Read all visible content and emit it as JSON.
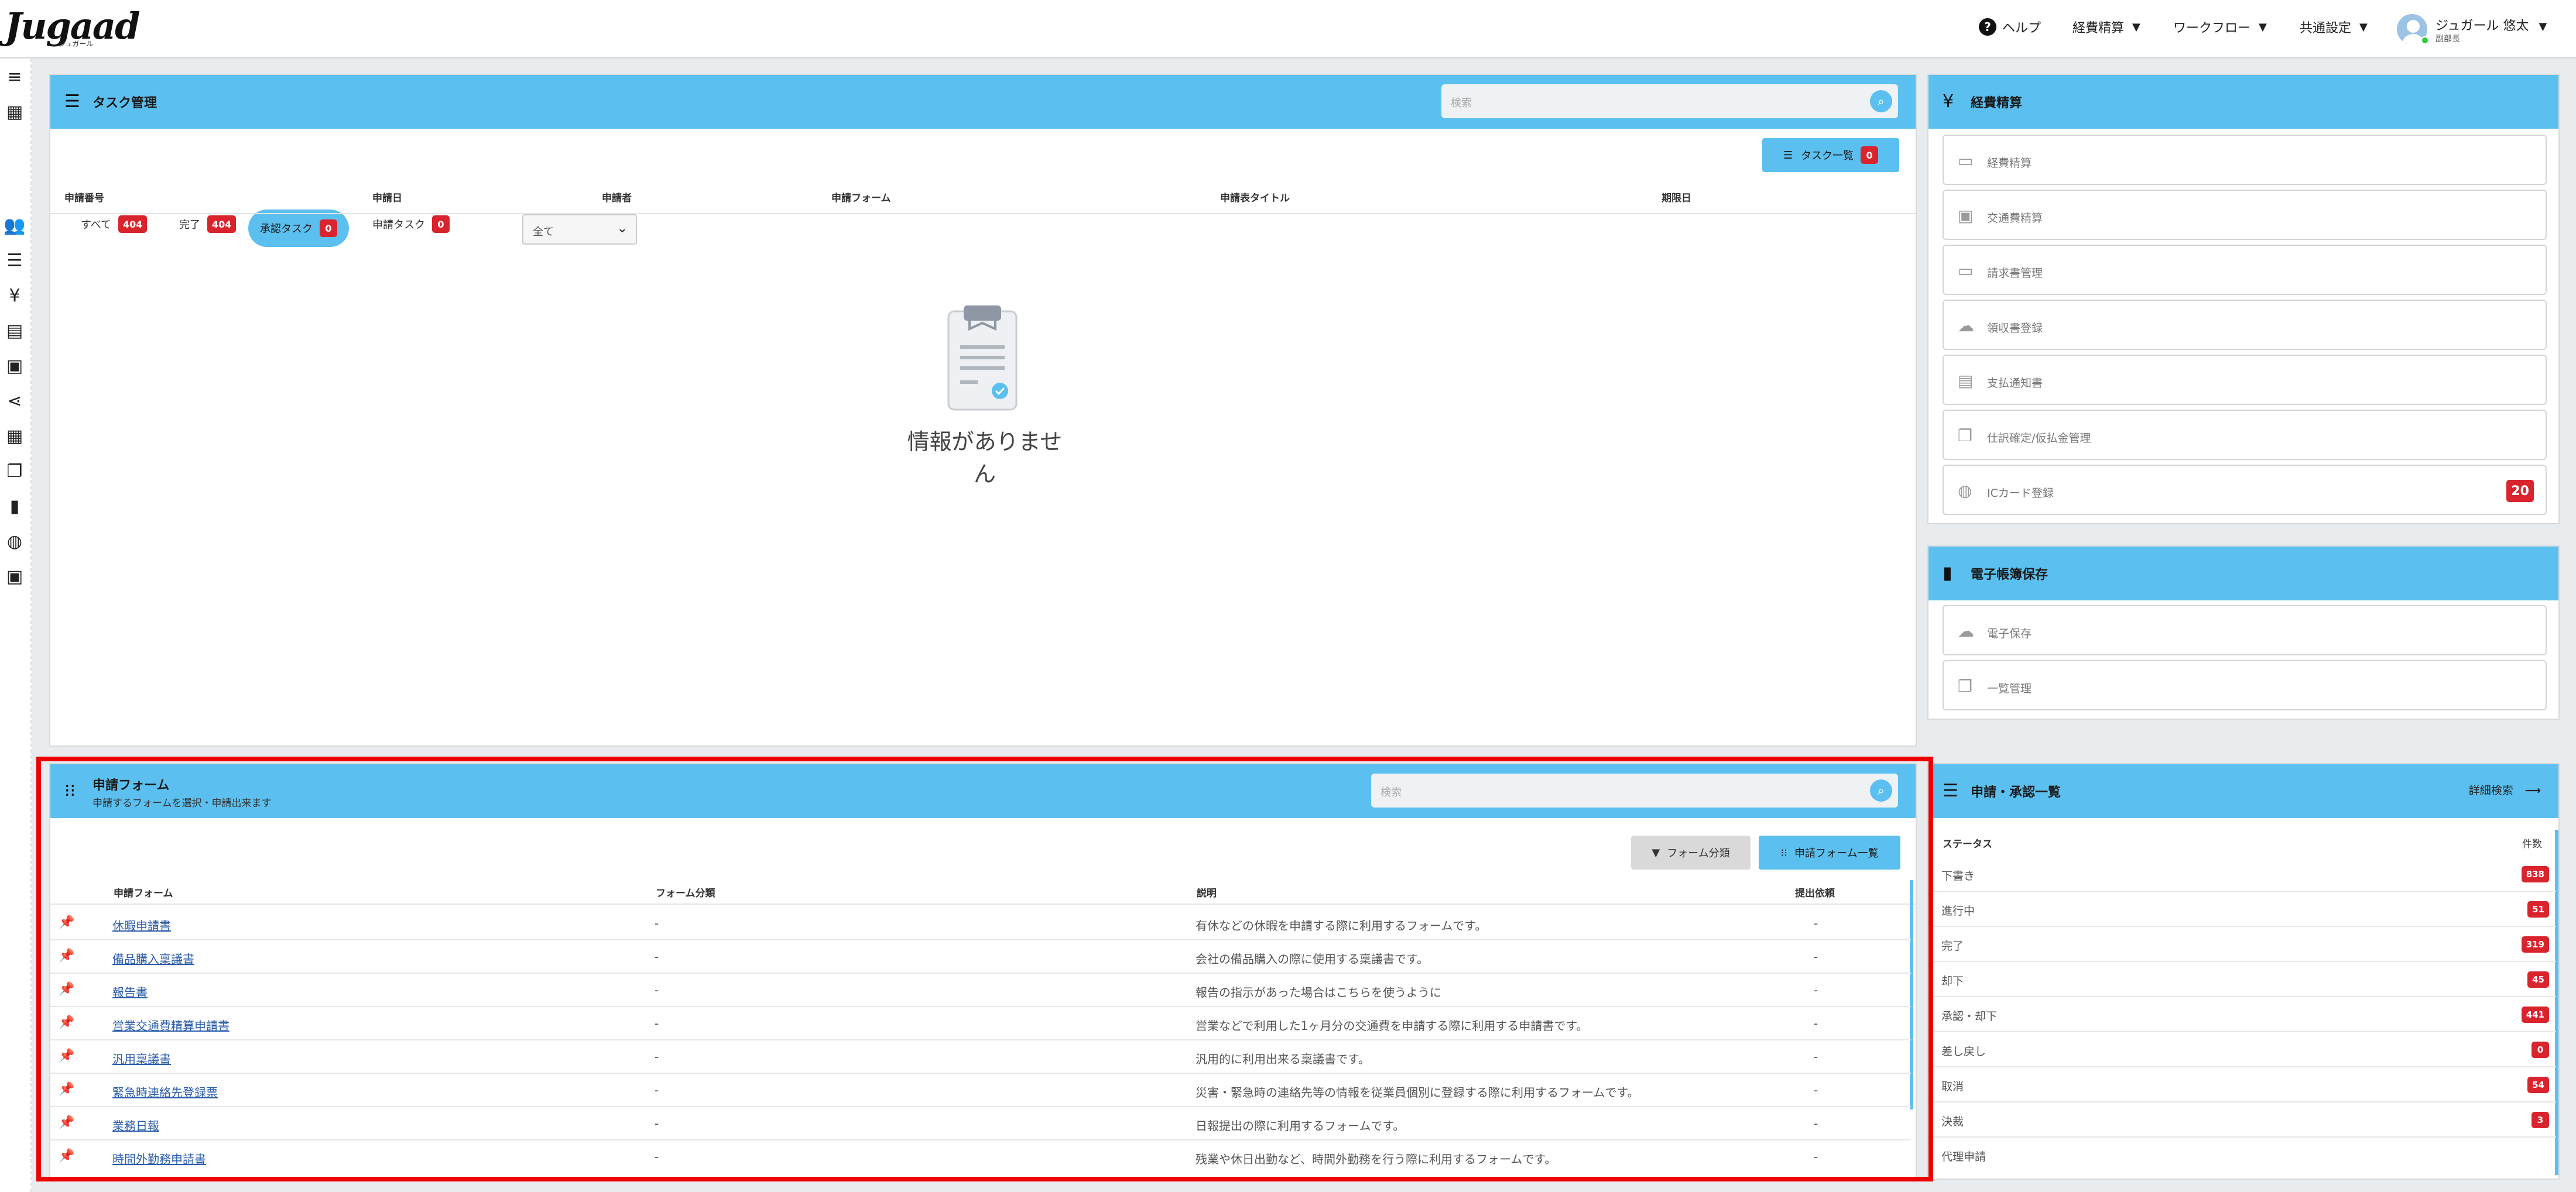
{
  "header": {
    "logo": "Jugaad",
    "logo_sub": "ジュガール",
    "help": "ヘルプ",
    "nav": [
      "経費精算",
      "ワークフロー",
      "共通設定"
    ],
    "user_name": "ジュガール 悠太",
    "user_dept": "副部長"
  },
  "task_panel": {
    "title": "タスク管理",
    "search_placeholder": "検索",
    "tabs": [
      {
        "label": "すべて",
        "count": "404"
      },
      {
        "label": "完了",
        "count": "404"
      },
      {
        "label": "承認タスク",
        "count": "0"
      },
      {
        "label": "申請タスク",
        "count": "0"
      }
    ],
    "filter_value": "全て",
    "list_button": "タスク一覧",
    "list_button_count": "0",
    "columns": [
      "申請番号",
      "申請日",
      "申請者",
      "申請フォーム",
      "申請表タイトル",
      "期限日"
    ],
    "empty_text": "情報がありません"
  },
  "expense_panel": {
    "title": "経費精算",
    "items": [
      {
        "label": "経費精算",
        "icon": "cash-icon"
      },
      {
        "label": "交通費精算",
        "icon": "train-icon"
      },
      {
        "label": "請求書管理",
        "icon": "card-icon"
      },
      {
        "label": "領収書登録",
        "icon": "cloud-upload-icon"
      },
      {
        "label": "支払通知書",
        "icon": "receipt-icon"
      },
      {
        "label": "仕訳確定/仮払金管理",
        "icon": "stack-icon"
      },
      {
        "label": "ICカード登録",
        "icon": "globe-icon",
        "count": "20"
      }
    ]
  },
  "storage_panel": {
    "title": "電子帳簿保存",
    "items": [
      {
        "label": "電子保存",
        "icon": "cloud-upload-icon"
      },
      {
        "label": "一覧管理",
        "icon": "stack-icon"
      }
    ]
  },
  "form_panel": {
    "title": "申請フォーム",
    "subtitle": "申請するフォームを選択・申請出来ます",
    "search_placeholder": "検索",
    "category_button": "フォーム分類",
    "list_button": "申請フォーム一覧",
    "columns": [
      "申請フォーム",
      "フォーム分類",
      "説明",
      "提出依頼"
    ],
    "rows": [
      {
        "name": "休暇申請書",
        "category": "-",
        "desc": "有休などの休暇を申請する際に利用するフォームです。",
        "count": "-"
      },
      {
        "name": "備品購入稟議書",
        "category": "-",
        "desc": "会社の備品購入の際に使用する稟議書です。",
        "count": "-"
      },
      {
        "name": "報告書",
        "category": "-",
        "desc": "報告の指示があった場合はこちらを使うように",
        "count": "-"
      },
      {
        "name": "営業交通費精算申請書",
        "category": "-",
        "desc": "営業などで利用した1ヶ月分の交通費を申請する際に利用する申請書です。",
        "count": "-"
      },
      {
        "name": "汎用稟議書",
        "category": "-",
        "desc": "汎用的に利用出来る稟議書です。",
        "count": "-"
      },
      {
        "name": "緊急時連絡先登録票",
        "category": "-",
        "desc": "災害・緊急時の連絡先等の情報を従業員個別に登録する際に利用するフォームです。",
        "count": "-"
      },
      {
        "name": "業務日報",
        "category": "-",
        "desc": "日報提出の際に利用するフォームです。",
        "count": "-"
      },
      {
        "name": "時間外勤務申請書",
        "category": "-",
        "desc": "残業や休日出勤など、時間外勤務を行う際に利用するフォームです。",
        "count": "-"
      }
    ]
  },
  "status_panel": {
    "title": "申請・承認一覧",
    "detail_link": "詳細検索",
    "col_status": "ステータス",
    "col_count": "件数",
    "rows": [
      {
        "label": "下書き",
        "count": "838"
      },
      {
        "label": "進行中",
        "count": "51"
      },
      {
        "label": "完了",
        "count": "319"
      },
      {
        "label": "却下",
        "count": "45"
      },
      {
        "label": "承認・却下",
        "count": "441"
      },
      {
        "label": "差し戻し",
        "count": "0"
      },
      {
        "label": "取消",
        "count": "54"
      },
      {
        "label": "決裁",
        "count": "3"
      },
      {
        "label": "代理申請",
        "count": ""
      }
    ]
  },
  "colors": {
    "accent": "#5bc0f0",
    "badge": "#d9232d",
    "highlight": "#e00000"
  }
}
